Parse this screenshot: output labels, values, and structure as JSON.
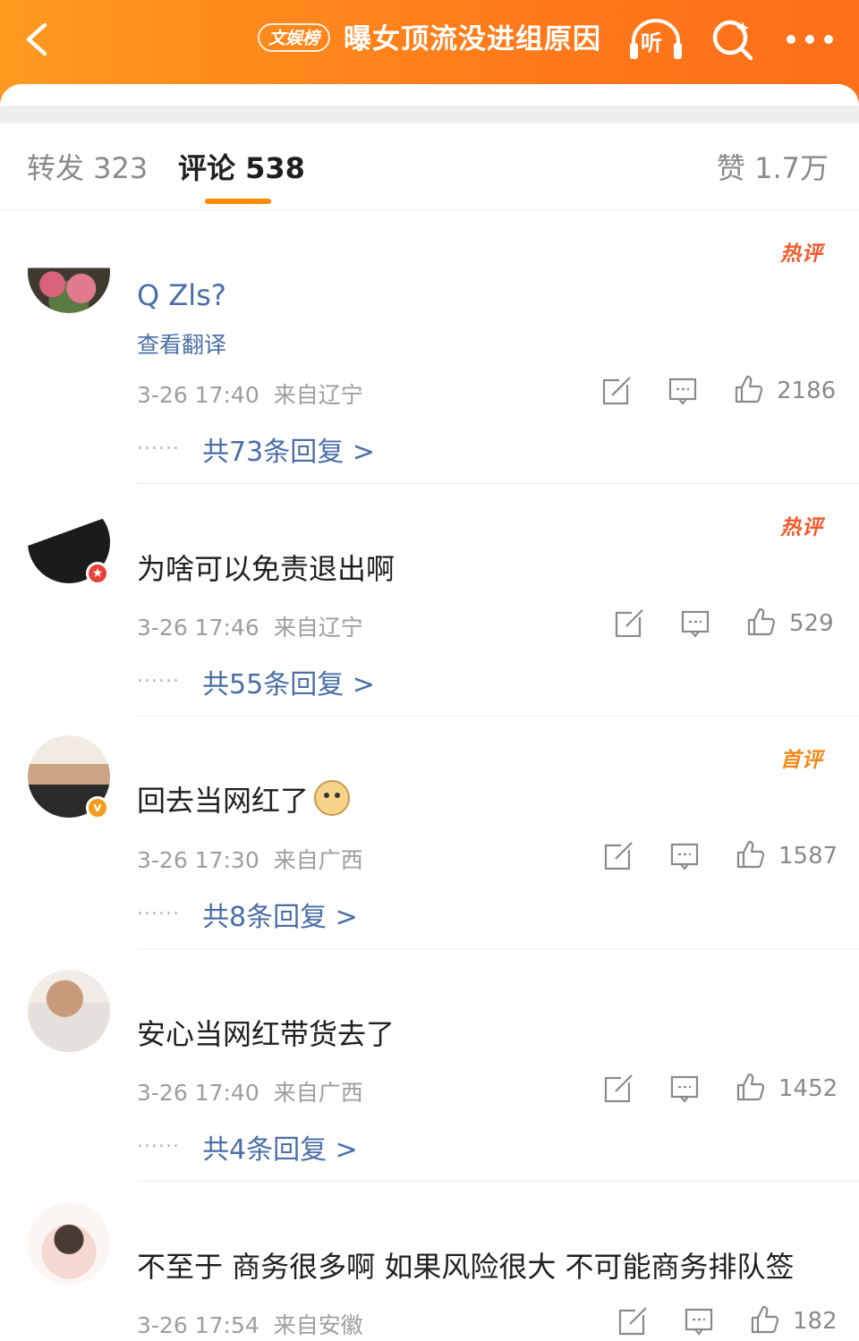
{
  "header": {
    "tag": "文娱榜",
    "title": "曝女顶流没进组原因",
    "listen_label": "听"
  },
  "tabs": {
    "repost": "转发 323",
    "comment": "评论 538",
    "likes": "赞 1.7万"
  },
  "comments": [
    {
      "badge": "热评",
      "text": "Q Zls?",
      "translate": "查看翻译",
      "time": "3-26 17:40",
      "location": "来自辽宁",
      "likes": "2186",
      "reply_dots": "······",
      "reply_link": "共73条回复 >"
    },
    {
      "badge": "热评",
      "text": "为啥可以免责退出啊",
      "time": "3-26 17:46",
      "location": "来自辽宁",
      "likes": "529",
      "reply_dots": "······",
      "reply_link": "共55条回复 >"
    },
    {
      "badge": "首评",
      "text": "回去当网红了",
      "time": "3-26 17:30",
      "location": "来自广西",
      "likes": "1587",
      "reply_dots": "······",
      "reply_link": "共8条回复 >"
    },
    {
      "text": "安心当网红带货去了",
      "time": "3-26 17:40",
      "location": "来自广西",
      "likes": "1452",
      "reply_dots": "······",
      "reply_link": "共4条回复 >"
    },
    {
      "text": "不至于 商务很多啊 如果风险很大 不可能商务排队签",
      "time": "3-26 17:54",
      "location": "来自安徽",
      "likes": "182"
    }
  ],
  "colors": {
    "header_orange": "#ff7a1a",
    "accent_underline": "#ff8a00",
    "link_blue": "#4a6ea8",
    "hot_badge": "#f25a2c"
  }
}
